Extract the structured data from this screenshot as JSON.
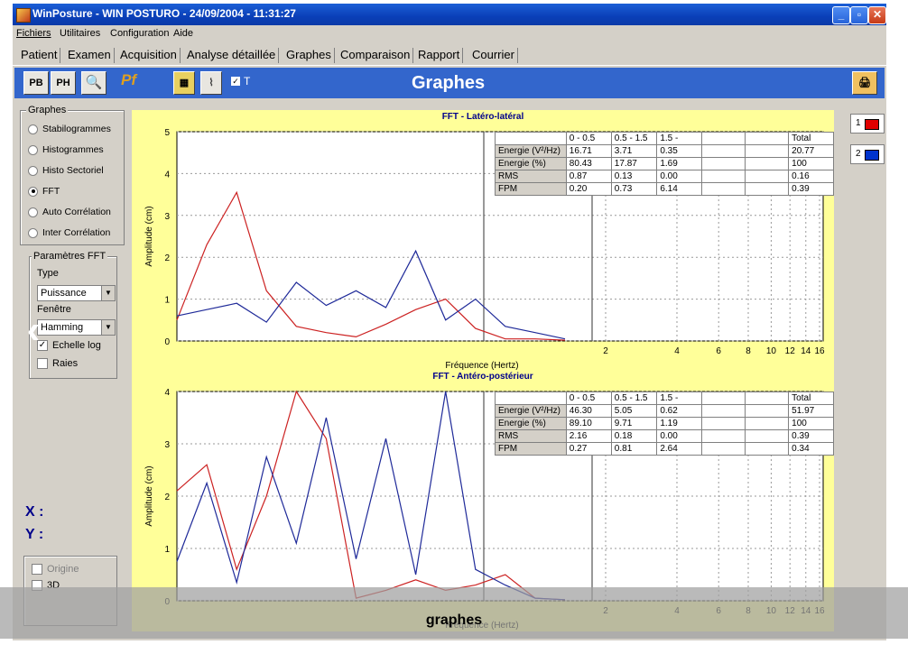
{
  "window": {
    "title": "WinPosture - WIN POSTURO - 24/09/2004 - 11:31:27",
    "controls": [
      "_",
      "▫",
      "✕"
    ]
  },
  "menu": [
    "Fichiers",
    "Utilitaires",
    "Configuration",
    "Aide"
  ],
  "tabs": [
    "Patient",
    "Examen",
    "Acquisition",
    "Analyse détaillée",
    "Graphes",
    "Comparaison",
    "Rapport",
    "Courrier"
  ],
  "active_tab": "Graphes",
  "toolbar": {
    "pb_label": "PB",
    "ph_label": "PH",
    "check_label": "T",
    "page_title": "Graphes"
  },
  "left_panel": {
    "graphes_title": "Graphes",
    "graph_options": [
      "Stabilogrammes",
      "Histogrammes",
      "Histo Sectoriel",
      "FFT",
      "Auto Corrélation",
      "Inter Corrélation"
    ],
    "selected_option": "FFT",
    "fft_title": "Paramètres FFT",
    "type_label": "Type",
    "type_value": "Puissance",
    "window_label": "Fenêtre",
    "window_value": "Hamming",
    "log_scale_label": "Echelle log",
    "log_scale_checked": true,
    "raies_label": "Raies",
    "raies_checked": false,
    "x_label": "X :",
    "y_label": "Y :",
    "origin_label": "Origine",
    "threed_label": "3D"
  },
  "series_buttons": [
    {
      "label": "1",
      "color": "#e00000"
    },
    {
      "label": "2",
      "color": "#0033cc"
    }
  ],
  "colors": {
    "series1": "#cc2222",
    "series2": "#1f2a99",
    "plot_bg": "#ffffff",
    "frame_bg": "#ffff99",
    "toolbar": "#3366cc"
  },
  "chart_data": [
    {
      "type": "line",
      "title": "FFT - Latéro-latéral",
      "xlabel": "Fréquence (Hertz)",
      "ylabel": "Amplitude (cm)",
      "ylim": [
        0,
        5
      ],
      "yticks": [
        "0",
        "1",
        "2",
        "3",
        "4",
        "5"
      ],
      "xticks": [
        "2",
        "4",
        "6",
        "8",
        "10",
        "12",
        "14",
        "16"
      ],
      "log_x": true,
      "series": [
        {
          "values": [
            0.5,
            2.3,
            3.55,
            1.2,
            0.35,
            0.2,
            0.1,
            0.4,
            0.75,
            1.0,
            0.3,
            0.05,
            0.05,
            0.02
          ]
        },
        {
          "values": [
            0.6,
            0.75,
            0.9,
            0.45,
            1.4,
            0.85,
            1.2,
            0.8,
            2.15,
            0.5,
            1.0,
            0.35,
            0.2,
            0.05
          ]
        }
      ],
      "table": {
        "headers": [
          "",
          "0 - 0.5",
          "0.5 - 1.5",
          "1.5 -",
          "",
          "",
          "Total"
        ],
        "rows": [
          [
            "Energie (V²/Hz)",
            "16.71",
            "3.71",
            "0.35",
            "",
            "",
            "20.77"
          ],
          [
            "Energie (%)",
            "80.43",
            "17.87",
            "1.69",
            "",
            "",
            "100"
          ],
          [
            "RMS",
            "0.87",
            "0.13",
            "0.00",
            "",
            "",
            "0.16"
          ],
          [
            "FPM",
            "0.20",
            "0.73",
            "6.14",
            "",
            "",
            "0.39"
          ]
        ]
      }
    },
    {
      "type": "line",
      "title": "FFT - Antéro-postérieur",
      "xlabel": "Fréquence (Hertz)",
      "ylabel": "Amplitude (cm)",
      "ylim": [
        0,
        4
      ],
      "yticks": [
        "0",
        "1",
        "2",
        "3",
        "4"
      ],
      "xticks": [
        "2",
        "4",
        "6",
        "8",
        "10",
        "12",
        "14",
        "16"
      ],
      "log_x": true,
      "series": [
        {
          "values": [
            2.1,
            2.6,
            0.6,
            2.0,
            4.0,
            3.1,
            0.05,
            0.2,
            0.4,
            0.2,
            0.3,
            0.5,
            0.05,
            0.02
          ]
        },
        {
          "values": [
            0.75,
            2.25,
            0.35,
            2.75,
            1.1,
            3.5,
            0.8,
            3.1,
            0.5,
            4.0,
            0.6,
            0.3,
            0.05,
            0.02
          ]
        }
      ],
      "table": {
        "headers": [
          "",
          "0 - 0.5",
          "0.5 - 1.5",
          "1.5 -",
          "",
          "",
          "Total"
        ],
        "rows": [
          [
            "Energie (V²/Hz)",
            "46.30",
            "5.05",
            "0.62",
            "",
            "",
            "51.97"
          ],
          [
            "Energie (%)",
            "89.10",
            "9.71",
            "1.19",
            "",
            "",
            "100"
          ],
          [
            "RMS",
            "2.16",
            "0.18",
            "0.00",
            "",
            "",
            "0.39"
          ],
          [
            "FPM",
            "0.27",
            "0.81",
            "2.64",
            "",
            "",
            "0.34"
          ]
        ]
      }
    }
  ],
  "caption": "graphes"
}
